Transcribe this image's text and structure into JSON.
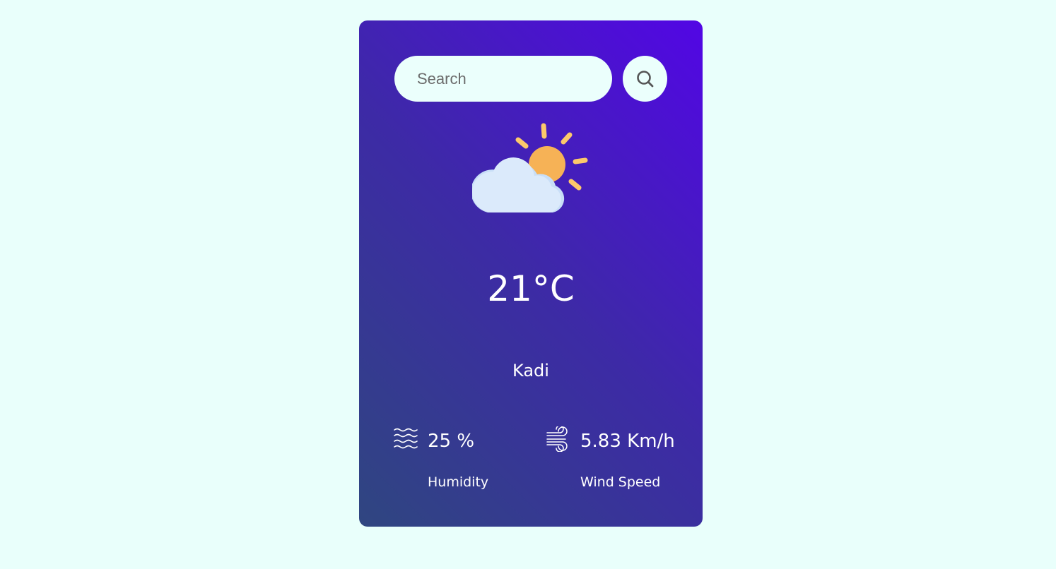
{
  "search": {
    "placeholder": "Search",
    "value": "",
    "button_icon": "search-icon"
  },
  "weather": {
    "icon": "partly-cloudy-icon",
    "temperature": "21°C",
    "city": "Kadi"
  },
  "details": {
    "humidity": {
      "icon": "humidity-waves-icon",
      "value": "25 %",
      "label": "Humidity"
    },
    "wind": {
      "icon": "wind-icon",
      "value": "5.83 Km/h",
      "label": "Wind Speed"
    }
  },
  "colors": {
    "page_background": "#e9fffb",
    "card_gradient_start": "#2f4680",
    "card_gradient_end": "#5206e5",
    "input_background": "#ebfffc",
    "sun": "#f6b256",
    "sun_rays": "#fcc96b",
    "cloud": "#dbeafb",
    "text": "#ffffff"
  }
}
